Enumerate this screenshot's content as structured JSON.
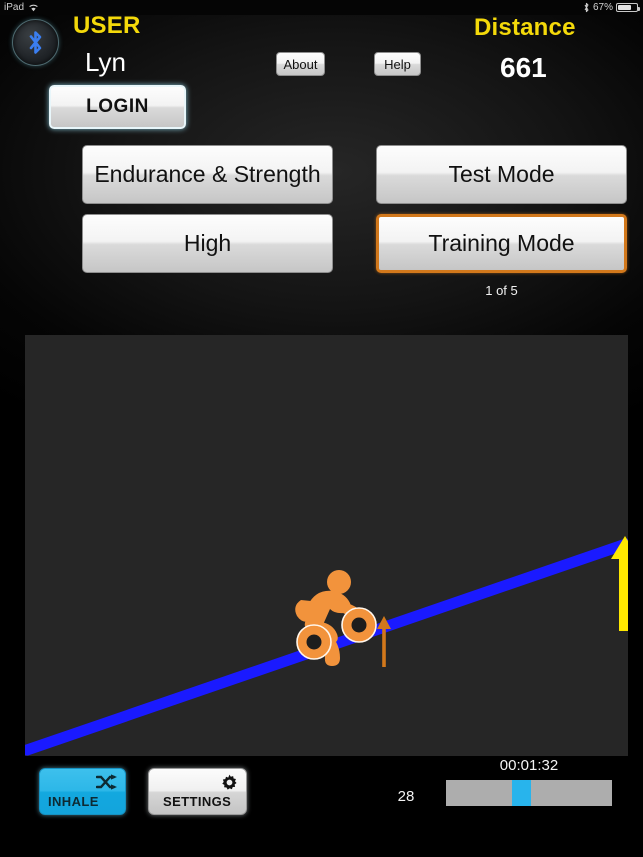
{
  "status_bar": {
    "device": "iPad",
    "wifi_icon": "wifi-icon",
    "bluetooth_icon": "bluetooth-icon",
    "battery_percent": "67%",
    "battery_icon": "battery-icon"
  },
  "header": {
    "bluetooth_badge_icon": "bluetooth-icon",
    "user_label": "USER",
    "user_name": "Lyn",
    "login_label": "LOGIN",
    "about_label": "About",
    "help_label": "Help",
    "distance_label": "Distance",
    "distance_value": "661"
  },
  "mode_buttons": {
    "endurance_label": "Endurance & Strength",
    "level_label": "High",
    "test_mode_label": "Test Mode",
    "training_mode_label": "Training Mode",
    "training_mode_selected": true,
    "page_indicator": "1 of 5"
  },
  "graph": {
    "background_color": "#262626",
    "line_color": "#1a1aff",
    "rider_color": "#f2933c",
    "goal_arrow_color": "#ffe800",
    "position_arrow_color": "#d2781b",
    "rider_icon": "cyclist-icon",
    "goal_arrow_icon": "up-arrow-icon",
    "position_arrow_icon": "up-arrow-icon"
  },
  "bottom_bar": {
    "inhale_label": "INHALE",
    "inhale_icon": "shuffle-icon",
    "inhale_color": "#2db7e8",
    "settings_label": "SETTINGS",
    "settings_icon": "gear-icon",
    "rep_count": "28",
    "timer": "00:01:32",
    "progress_track_color": "#adadad",
    "progress_marker_color": "#28b4ec"
  }
}
